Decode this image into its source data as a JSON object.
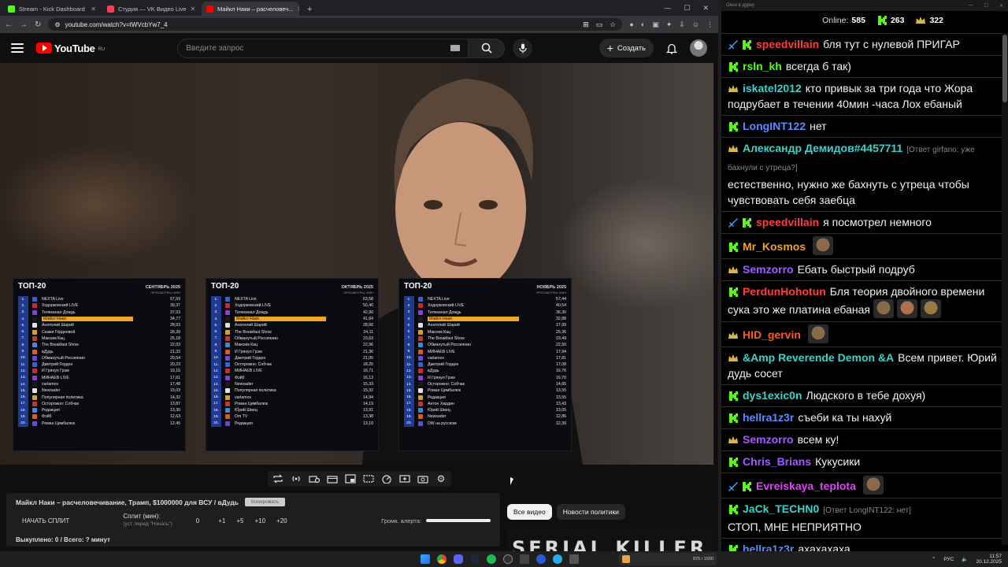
{
  "browser": {
    "tabs": [
      {
        "title": "Stream - Kick Dashboard",
        "favicon_color": "#53fc18"
      },
      {
        "title": "Студия — VK Видео Live",
        "favicon_color": "#ff3f5a"
      },
      {
        "title": "Майкл Наки – расчеловеч...",
        "favicon_color": "#ff0000",
        "active": true
      }
    ],
    "new_tab": "+",
    "url": "youtube.com/watch?v=tWVcbYw7_4"
  },
  "youtube": {
    "logo_text": "YouTube",
    "logo_region": "RU",
    "search_placeholder": "Введите запрос",
    "create_label": "Создать"
  },
  "panels": [
    {
      "title": "ТОП-20",
      "month": "СЕНТЯБРЬ 2025",
      "subtitle": "ПРОСМОТРЫ, МЛН",
      "rows": [
        {
          "n": "1.",
          "name": "NEXTA Live",
          "val": "57,59"
        },
        {
          "n": "2.",
          "name": "Ходорковский LIVE",
          "val": "39,37"
        },
        {
          "n": "3.",
          "name": "Телеканал Дождь",
          "val": "37,53"
        },
        {
          "n": "4.",
          "name": "Майкл Наки",
          "val": "34,77",
          "hl": true
        },
        {
          "n": "5.",
          "name": "Анатолий Шарий",
          "val": "28,53"
        },
        {
          "n": "6.",
          "name": "Скажи Гордеевой",
          "val": "26,39"
        },
        {
          "n": "7.",
          "name": "Максим Кац",
          "val": "25,18"
        },
        {
          "n": "8.",
          "name": "The Breakfast Show",
          "val": "22,03"
        },
        {
          "n": "9.",
          "name": "вДудь",
          "val": "21,33"
        },
        {
          "n": "10.",
          "name": "Обманутый Россиянин",
          "val": "20,54"
        },
        {
          "n": "11.",
          "name": "Дмитрий Гордон",
          "val": "20,23"
        },
        {
          "n": "12.",
          "name": "И Грянул Грэм",
          "val": "19,16"
        },
        {
          "n": "13.",
          "name": "МИНАЕВ LIVE",
          "val": "17,61"
        },
        {
          "n": "14.",
          "name": "varlamov",
          "val": "17,48"
        },
        {
          "n": "15.",
          "name": "Newsader",
          "val": "15,03"
        },
        {
          "n": "16.",
          "name": "Популярная политика",
          "val": "14,32"
        },
        {
          "n": "17.",
          "name": "Осторожно: Собчак",
          "val": "13,87"
        },
        {
          "n": "18.",
          "name": "Редакция",
          "val": "13,30"
        },
        {
          "n": "19.",
          "name": "Фэйб",
          "val": "12,63"
        },
        {
          "n": "20.",
          "name": "Роман Цимбалюк",
          "val": "12,45"
        }
      ]
    },
    {
      "title": "ТОП-20",
      "month": "ОКТЯБРЬ 2025",
      "subtitle": "ПРОСМОТРЫ, МЛН",
      "rows": [
        {
          "n": "1.",
          "name": "NEXTA Live",
          "val": "63,58"
        },
        {
          "n": "2.",
          "name": "Ходорковский LIVE",
          "val": "50,40"
        },
        {
          "n": "3.",
          "name": "Телеканал Дождь",
          "val": "42,90"
        },
        {
          "n": "4.",
          "name": "Майкл Наки",
          "val": "41,64",
          "hl": true
        },
        {
          "n": "5.",
          "name": "Анатолий Шарий",
          "val": "28,66"
        },
        {
          "n": "6.",
          "name": "The Breakfast Show",
          "val": "24,11"
        },
        {
          "n": "7.",
          "name": "Обманутый Россиянин",
          "val": "23,63"
        },
        {
          "n": "8.",
          "name": "Максим Кац",
          "val": "22,96"
        },
        {
          "n": "9.",
          "name": "И Грянул Грэм",
          "val": "21,36"
        },
        {
          "n": "10.",
          "name": "Дмитрий Гордон",
          "val": "21,05"
        },
        {
          "n": "11.",
          "name": "Осторожно: Собчак",
          "val": "18,25"
        },
        {
          "n": "12.",
          "name": "МИНАЕВ LIVE",
          "val": "16,71"
        },
        {
          "n": "13.",
          "name": "Фэйб",
          "val": "16,13"
        },
        {
          "n": "14.",
          "name": "Newsader",
          "val": "15,33"
        },
        {
          "n": "15.",
          "name": "Популярная политика",
          "val": "15,32"
        },
        {
          "n": "16.",
          "name": "varlamov",
          "val": "14,94"
        },
        {
          "n": "17.",
          "name": "Роман Цимбалюк",
          "val": "14,19"
        },
        {
          "n": "18.",
          "name": "Юрий Швец",
          "val": "13,91"
        },
        {
          "n": "19.",
          "name": "Om TV",
          "val": "13,38"
        },
        {
          "n": "20.",
          "name": "Редакция",
          "val": "13,10"
        }
      ]
    },
    {
      "title": "ТОП-20",
      "month": "НОЯБРЬ 2025",
      "subtitle": "ПРОСМОТРЫ, МЛН",
      "rows": [
        {
          "n": "1.",
          "name": "NEXTA Live",
          "val": "57,44"
        },
        {
          "n": "2.",
          "name": "Ходорковский LIVE",
          "val": "40,54"
        },
        {
          "n": "3.",
          "name": "Телеканал Дождь",
          "val": "36,30"
        },
        {
          "n": "4.",
          "name": "Майкл Наки",
          "val": "32,88",
          "hl": true
        },
        {
          "n": "5.",
          "name": "Анатолий Шарий",
          "val": "27,99"
        },
        {
          "n": "6.",
          "name": "Максим Кац",
          "val": "25,36"
        },
        {
          "n": "7.",
          "name": "The Breakfast Show",
          "val": "23,49"
        },
        {
          "n": "8.",
          "name": "Обманутый Россиянин",
          "val": "22,50"
        },
        {
          "n": "9.",
          "name": "МИНАЕВ LIVE",
          "val": "17,94"
        },
        {
          "n": "10.",
          "name": "varlamov",
          "val": "17,81"
        },
        {
          "n": "11.",
          "name": "Дмитрий Гордон",
          "val": "17,08"
        },
        {
          "n": "12.",
          "name": "вДудь",
          "val": "16,76"
        },
        {
          "n": "13.",
          "name": "И Грянул Грэм",
          "val": "16,70"
        },
        {
          "n": "14.",
          "name": "Осторожно: Собчак",
          "val": "14,65"
        },
        {
          "n": "15.",
          "name": "Роман Цимбалюк",
          "val": "13,55"
        },
        {
          "n": "16.",
          "name": "Редакция",
          "val": "13,55"
        },
        {
          "n": "17.",
          "name": "Антон Хардин",
          "val": "13,43"
        },
        {
          "n": "18.",
          "name": "Юрий Швец",
          "val": "13,05"
        },
        {
          "n": "19.",
          "name": "Newsader",
          "val": "12,86"
        },
        {
          "n": "20.",
          "name": "DW на русском",
          "val": "12,39"
        }
      ]
    }
  ],
  "helper": {
    "title": "Майкл Наки – расчеловечивание, Трамп, $1000000 для ВСУ / вДудь",
    "copy_btn": "Копировать",
    "start_btn": "НАЧАТЬ СПЛИТ",
    "split_label": "Сплит (мин):",
    "split_hint": "(уст. перед \"Начать\")",
    "split_values": [
      "0",
      "+1",
      "+5",
      "+10",
      "+20"
    ],
    "volume_label": "Громк. алерта:",
    "status": "Выкуплено: 0 / Всего: ? минут"
  },
  "chips": [
    "Все видео",
    "Новости политики"
  ],
  "thumbnail_text": "SERIAL KILLER",
  "chat": {
    "window_title": "Окно в дурку",
    "online_label": "Online:",
    "online_value": "585",
    "kick_count": "263",
    "vk_count": "322",
    "messages": [
      {
        "badges": [
          "twitch",
          "kick"
        ],
        "nick": "speedvillain",
        "color": "#ff3b3b",
        "text": "бля тут с нулевой ПРИГАР"
      },
      {
        "badges": [
          "kick"
        ],
        "nick": "rsln_kh",
        "color": "#53fc18",
        "text": "всегда б так)"
      },
      {
        "badges": [
          "vk"
        ],
        "nick": "iskatel2012",
        "color": "#3fd0c9",
        "text": "кто привык за три года что Жора подрубает в течении 40мин -часа Лох ебаный"
      },
      {
        "badges": [
          "kick"
        ],
        "nick": "LongINT122",
        "color": "#5a8bff",
        "text": "нет"
      },
      {
        "badges": [
          "vk"
        ],
        "nick": "Александр Демидов#4457711",
        "color": "#3fd0c9",
        "reply": "[Ответ girfano: уже бахнули с утреца?]",
        "text": "естественно, нужно же бахнуть с утреца чтобы чувствовать себя заебца"
      },
      {
        "badges": [
          "twitch",
          "kick"
        ],
        "nick": "speedvillain",
        "color": "#ff3b3b",
        "text": "я посмотрел немного"
      },
      {
        "badges": [
          "kick"
        ],
        "nick": "Mr_Kosmos",
        "color": "#f0a028",
        "text": "",
        "emotes": 1
      },
      {
        "badges": [
          "vk"
        ],
        "nick": "Semzorro",
        "color": "#a05cff",
        "text": "Ебать быстрый подруб"
      },
      {
        "badges": [
          "kick"
        ],
        "nick": "PerdunHohotun",
        "color": "#ff3b3b",
        "text": "Бля теория двойного времени сука это же платина ебаная",
        "emotes": 3
      },
      {
        "badges": [
          "vk"
        ],
        "nick": "HID_gervin",
        "color": "#ff5a1e",
        "text": "",
        "emotes": 1
      },
      {
        "badges": [
          "vk"
        ],
        "nick": "&Amp Reverende Demon &A",
        "color": "#3fd0c9",
        "text": "Всем привет. Юрий дудь сосет"
      },
      {
        "badges": [
          "kick"
        ],
        "nick": "dys1exic0n",
        "color": "#3fd0c9",
        "text": "Людского в тебе дохуя)"
      },
      {
        "badges": [
          "kick"
        ],
        "nick": "hellra1z3r",
        "color": "#5a8bff",
        "text": "съеби ка ты нахуй"
      },
      {
        "badges": [
          "vk"
        ],
        "nick": "Semzorro",
        "color": "#a05cff",
        "text": "всем ку!"
      },
      {
        "badges": [
          "kick"
        ],
        "nick": "Chris_Brians",
        "color": "#a05cff",
        "text": "Кукусики"
      },
      {
        "badges": [
          "twitch",
          "kick"
        ],
        "nick": "Evreiskaya_teplota",
        "color": "#e040fb",
        "text": "",
        "emotes": 1
      },
      {
        "badges": [
          "kick"
        ],
        "nick": "JaCk_TECHN0",
        "color": "#3fd0c9",
        "reply": "[Ответ LongINT122: нет]",
        "text": "СТОП, МНЕ НЕПРИЯТНО"
      },
      {
        "badges": [
          "kick"
        ],
        "nick": "hellra1z3r",
        "color": "#5a8bff",
        "text": "ахахахаха"
      }
    ]
  },
  "taskbar": {
    "game_text": "875 / 1500",
    "lang": "РУС",
    "time": "11:57",
    "date": "20.12.2025"
  }
}
